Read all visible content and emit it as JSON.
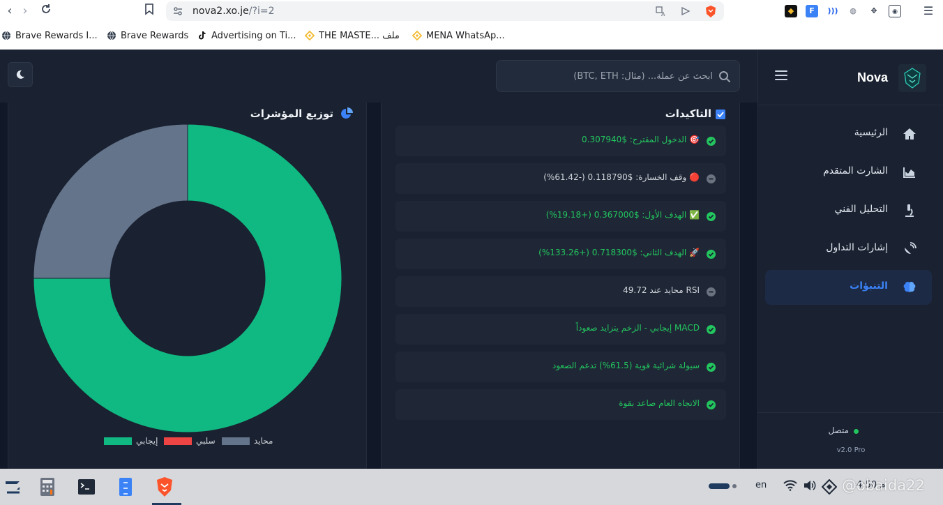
{
  "browser": {
    "url_host": "nova2.xo.je",
    "url_path": "/?i=2",
    "bookmarks": [
      {
        "label": "Brave Rewards I..."
      },
      {
        "label": "Brave Rewards"
      },
      {
        "label": "Advertising on Ti..."
      },
      {
        "label": "THE MASTE... ملف"
      },
      {
        "label": "MENA WhatsAp..."
      }
    ]
  },
  "header": {
    "search_placeholder": "ابحث عن عملة... (مثال: BTC, ETH)"
  },
  "sidebar": {
    "brand": "Nova",
    "items": [
      {
        "label": "الرئيسية",
        "icon": "home-icon"
      },
      {
        "label": "الشارت المتقدم",
        "icon": "chart-area-icon"
      },
      {
        "label": "التحليل الفني",
        "icon": "microscope-icon"
      },
      {
        "label": "إشارات التداول",
        "icon": "satellite-dish-icon"
      },
      {
        "label": "التنبؤات",
        "icon": "brain-icon",
        "active": true
      }
    ],
    "status": "متصل",
    "version": "v2.0 Pro"
  },
  "confirmations": {
    "title": "التاكيدات",
    "rows": [
      {
        "text": "🎯 الدخول المقترح: $0.307940",
        "state": "positive"
      },
      {
        "text": "🔴 وقف الخسارة: $0.118790 (-61.42%)",
        "state": "neutral"
      },
      {
        "text": "✅ الهدف الأول: $0.367000 (+19.18%)",
        "state": "positive"
      },
      {
        "text": "🚀 الهدف الثاني: $0.718300 (+133.26%)",
        "state": "positive"
      },
      {
        "text": "RSI محايد عند 49.72",
        "state": "neutral"
      },
      {
        "text": "MACD إيجابي - الزخم يتزايد صعوداً",
        "state": "positive"
      },
      {
        "text": "سيولة شرائية قوية (61.5%) تدعم الصعود",
        "state": "positive"
      },
      {
        "text": "الاتجاه العام صاعد بقوة",
        "state": "positive"
      }
    ]
  },
  "chart_data": {
    "type": "pie",
    "title": "توزيع المؤشرات",
    "categories": [
      "إيجابي",
      "سلبي",
      "محايد"
    ],
    "values": [
      6,
      0,
      2
    ],
    "colors": [
      "#10b981",
      "#ef4444",
      "#64748b"
    ],
    "donut": true,
    "legend_position": "bottom"
  },
  "taskbar": {
    "lang": "en",
    "clock": "4:50 م",
    "watermark": "@obaida22"
  }
}
